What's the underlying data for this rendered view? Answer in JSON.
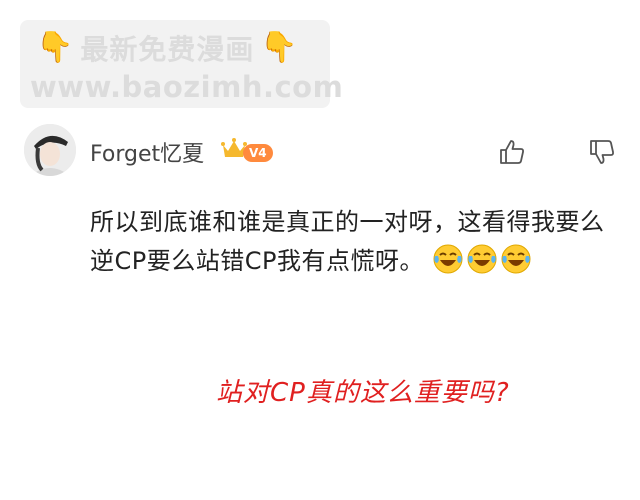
{
  "watermark": {
    "line1": "最新免费漫画",
    "line2": "www.baozimh.com"
  },
  "comment": {
    "username": "Forget忆夏",
    "vip_level": "V4",
    "text": "所以到底谁和谁是真正的一对呀，这看得我要么逆CP要么站错CP我有点慌呀。",
    "emoji_name": "laughing-crying",
    "emoji_count": 3
  },
  "annotation": "站对CP真的这么重要吗?",
  "colors": {
    "vip_badge": "#ff8a3d",
    "annotation": "#e02020",
    "watermark_bg": "#f2f2f2"
  }
}
